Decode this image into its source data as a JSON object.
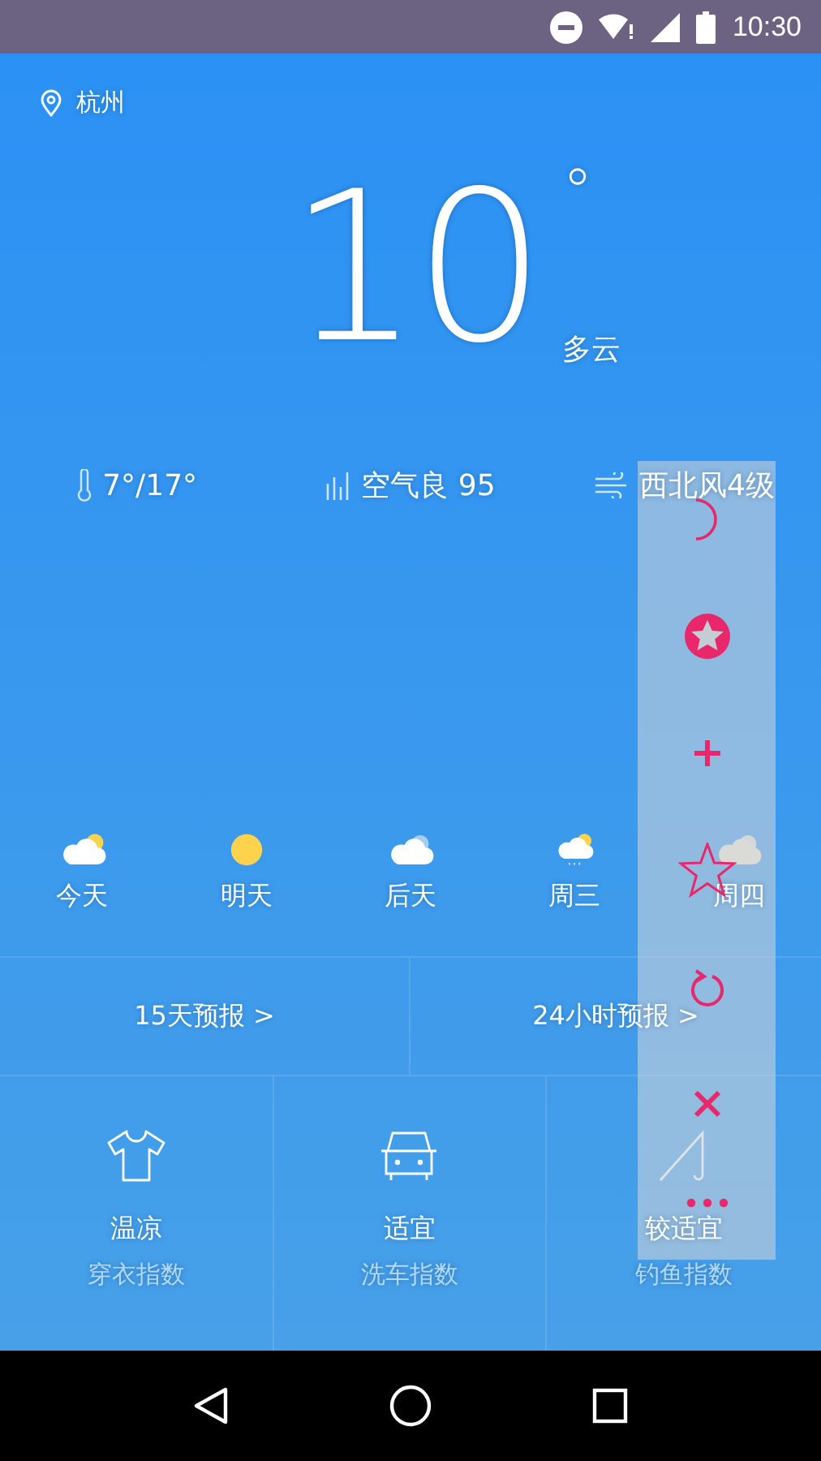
{
  "status_bar": {
    "time": "10:30"
  },
  "location": {
    "city": "杭州"
  },
  "current": {
    "temperature": "10",
    "degree": "°",
    "condition": "多云"
  },
  "stats": [
    {
      "kind": "temperature",
      "text": "7°/17°"
    },
    {
      "kind": "air",
      "text": "空气良 95"
    },
    {
      "kind": "wind",
      "text": "西北风4级"
    }
  ],
  "forecast": [
    {
      "kind": "partly-cloudy",
      "label": "今天"
    },
    {
      "kind": "sunny",
      "label": "明天"
    },
    {
      "kind": "cloudy",
      "label": "后天"
    },
    {
      "kind": "rain",
      "label": "周三"
    },
    {
      "kind": "overcast",
      "label": "周四"
    }
  ],
  "links": [
    {
      "label": "15天预报",
      "arrow": ">"
    },
    {
      "label": "24小时预报",
      "arrow": ">"
    }
  ],
  "indices": [
    {
      "kind": "clothing",
      "value": "温凉",
      "name": "穿衣指数"
    },
    {
      "kind": "car-wash",
      "value": "适宜",
      "name": "洗车指数"
    },
    {
      "kind": "fishing",
      "value": "较适宜",
      "name": "钓鱼指数"
    }
  ],
  "floating_toolbar": [
    {
      "kind": "moon"
    },
    {
      "kind": "star-badge"
    },
    {
      "kind": "plus"
    },
    {
      "kind": "star"
    },
    {
      "kind": "refresh"
    },
    {
      "kind": "close"
    },
    {
      "kind": "more"
    }
  ]
}
